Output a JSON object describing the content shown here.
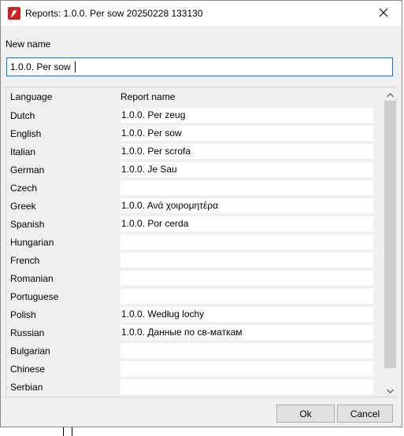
{
  "window": {
    "title": "Reports: 1.0.0. Per sow 20250228 133130"
  },
  "form": {
    "new_name_label": "New name",
    "new_name_value": "1.0.0. Per sow"
  },
  "table": {
    "headers": {
      "language": "Language",
      "report_name": "Report name"
    },
    "rows": [
      {
        "language": "Dutch",
        "report_name": "1.0.0. Per zeug"
      },
      {
        "language": "English",
        "report_name": "1.0.0. Per sow"
      },
      {
        "language": "Italian",
        "report_name": "1.0.0. Per scrofa"
      },
      {
        "language": "German",
        "report_name": "1.0.0. Je Sau"
      },
      {
        "language": "Czech",
        "report_name": ""
      },
      {
        "language": "Greek",
        "report_name": "1.0.0. Ανά χοιρομητέρα"
      },
      {
        "language": "Spanish",
        "report_name": "1.0.0. Por cerda"
      },
      {
        "language": "Hungarian",
        "report_name": ""
      },
      {
        "language": "French",
        "report_name": ""
      },
      {
        "language": "Romanian",
        "report_name": ""
      },
      {
        "language": "Portuguese",
        "report_name": ""
      },
      {
        "language": "Polish",
        "report_name": "1.0.0. Według lochy"
      },
      {
        "language": "Russian",
        "report_name": "1.0.0. Данные по св-маткам"
      },
      {
        "language": "Bulgarian",
        "report_name": ""
      },
      {
        "language": "Chinese",
        "report_name": ""
      },
      {
        "language": "Serbian",
        "report_name": ""
      }
    ]
  },
  "buttons": {
    "ok": "Ok",
    "cancel": "Cancel"
  },
  "icons": {
    "app": "app-logo-icon",
    "close": "close-icon",
    "scroll_up": "chevron-up-icon",
    "scroll_down": "chevron-down-icon"
  },
  "colors": {
    "accent": "#0078d7",
    "app_icon": "#cc1f1f",
    "dialog_bg": "#f0f0f0"
  }
}
